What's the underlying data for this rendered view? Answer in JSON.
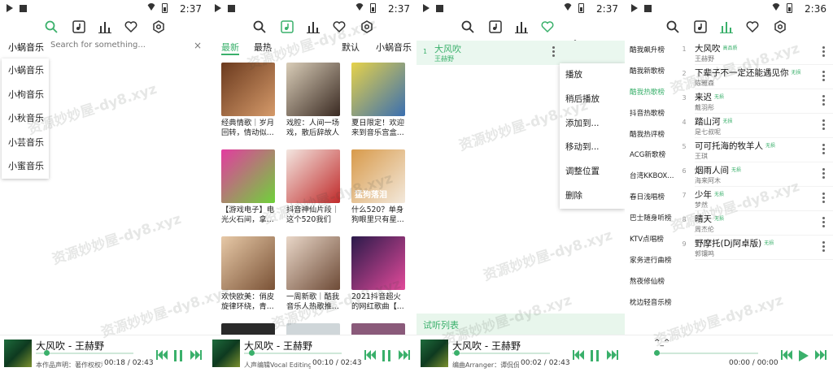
{
  "theme": {
    "accent": "#3ab06b"
  },
  "panels": [
    {
      "status_time": "2:37",
      "search": {
        "source_label": "小蜗音乐",
        "placeholder": "Search for something...",
        "clear": "×"
      },
      "source_options": [
        "小蜗音乐",
        "小枸音乐",
        "小秋音乐",
        "小芸音乐",
        "小蜜音乐"
      ],
      "player": {
        "title": "大风吹 - 王赫野",
        "subtitle": "本作品声明：著作权权利...",
        "time": "00:18 / 02:43"
      }
    },
    {
      "status_time": "2:37",
      "tabs": [
        "最新",
        "最热",
        "默认",
        "小蜗音乐"
      ],
      "playlists": [
        {
          "title": "经典情歌｜岁月回转，情动似...",
          "color1": "#6b3a1e",
          "color2": "#d59a6a"
        },
        {
          "title": "戏腔：人间一场戏，散后辞故人",
          "color1": "#d9cdb8",
          "color2": "#3a2a22"
        },
        {
          "title": "夏日限定！欢迎来到音乐宫盒...",
          "color1": "#e6d24a",
          "color2": "#3a6fb0"
        },
        {
          "title": "【游戏电子】电光火石间，拿...",
          "color1": "#e33ba0",
          "color2": "#6fd23a"
        },
        {
          "title": "抖音神仙片段｜这个520我们就...",
          "color1": "#f3e6e0",
          "color2": "#c02a2a"
        },
        {
          "title": "什么520？单身狗眼里只有星...",
          "color1": "#d89a4a",
          "color2": "#f3e9dc"
        },
        {
          "title": "欢快欧美：俏皮旋律环绕，青...",
          "color1": "#e7c9a7",
          "color2": "#7a5236"
        },
        {
          "title": "一周新歌｜酷我音乐人热歌推...",
          "color1": "#e9d7c8",
          "color2": "#6d4a36"
        },
        {
          "title": "2021抖音超火的网红歌曲【...",
          "color1": "#2a1a4a",
          "color2": "#e24a9a"
        }
      ],
      "dog_overlay": "猛狗落泪",
      "player": {
        "title": "大风吹 - 王赫野",
        "subtitle": "人声编辑Vocal Editing：...",
        "time": "00:10 / 02:43"
      }
    },
    {
      "status_time": "2:37",
      "playlist_item": {
        "num": "1",
        "name": "大风吹",
        "artist": "王赫野"
      },
      "menu": [
        "播放",
        "稍后播放",
        "添加到...",
        "移动到...",
        "调整位置",
        "删除"
      ],
      "trial_list": "试听列表",
      "player": {
        "title": "大风吹 - 王赫野",
        "subtitle": "编曲Arranger：谭侃侃",
        "time": "00:02 / 02:43"
      }
    },
    {
      "status_time": "2:36",
      "charts": [
        "酷我飙升榜",
        "酷我新歌榜",
        "酷我热歌榜",
        "抖音热歌榜",
        "酷我热评榜",
        "ACG新歌榜",
        "台湾KKBOX...",
        "春日浅唱榜",
        "巴士随身听榜",
        "KTV点唱榜",
        "家务进行曲榜",
        "熬夜修仙榜",
        "枕边轻音乐榜"
      ],
      "active_chart": 2,
      "songs": [
        {
          "num": "1",
          "name": "大风吹",
          "artist": "王赫野",
          "badge": "高品质"
        },
        {
          "num": "2",
          "name": "下辈子不一定还能遇见你",
          "artist": "陈雅森",
          "badge": "无损"
        },
        {
          "num": "3",
          "name": "来迟",
          "artist": "戴羽彤",
          "badge": "无损"
        },
        {
          "num": "4",
          "name": "踏山河",
          "artist": "是七叔呢",
          "badge": "无损"
        },
        {
          "num": "5",
          "name": "可可托海的牧羊人",
          "artist": "王琪",
          "badge": "无损"
        },
        {
          "num": "6",
          "name": "烟雨人间",
          "artist": "海来阿木",
          "badge": "无损"
        },
        {
          "num": "7",
          "name": "少年",
          "artist": "梦然",
          "badge": "无损"
        },
        {
          "num": "8",
          "name": "晴天",
          "artist": "周杰伦",
          "badge": "无损"
        },
        {
          "num": "9",
          "name": "野摩托(Dj阿卓版)",
          "artist": "郭镶鸣",
          "badge": "无损"
        }
      ],
      "player": {
        "title": "^_^",
        "time": "00:00 / 00:00"
      }
    }
  ],
  "watermark": "资源妙妙屋-dy8.xyz"
}
